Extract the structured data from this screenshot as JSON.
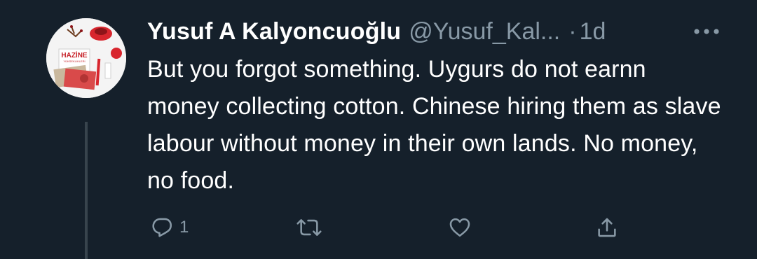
{
  "tweet": {
    "author_name": "Yusuf A Kalyoncuoğlu",
    "author_handle": "@Yusuf_Kal...",
    "separator": "·",
    "age": "1d",
    "text": "But you forgot something. Uygurs do not earnn money collecting cotton. Chinese hiring them as slave labour without money in their own lands. No money, no food.",
    "reply_count": "1"
  },
  "avatar": {
    "book_title": "HAZİNE",
    "book_subtitle": "YÜKSEKLİKLERİ"
  },
  "icons": {
    "more": "more-horizontal-icon",
    "reply": "reply-bubble-icon",
    "retweet": "retweet-icon",
    "like": "heart-icon",
    "share": "share-icon"
  },
  "colors": {
    "background": "#15202b",
    "text_primary": "#ffffff",
    "text_secondary": "#8899a6",
    "thread_line": "#38444d"
  }
}
